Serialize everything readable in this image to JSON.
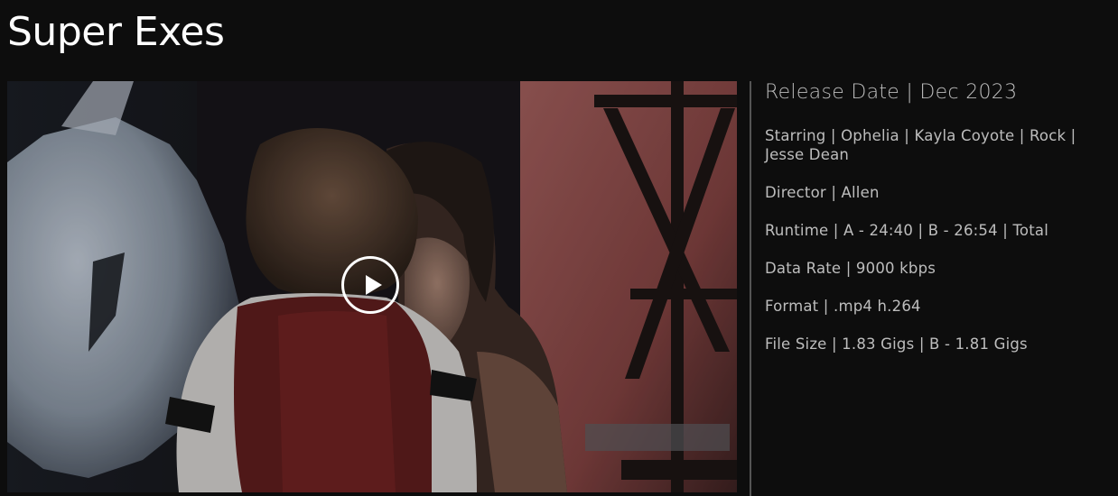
{
  "title": "Super Exes",
  "video": {
    "thumbnail": "video-still-two-people",
    "play_icon": "play-icon"
  },
  "details": {
    "release_date": "Release Date | Dec 2023",
    "starring": "Starring | Ophelia | Kayla Coyote | Rock | Jesse Dean",
    "director": "Director | Allen",
    "runtime": "Runtime | A - 24:40 | B - 26:54 | Total",
    "data_rate": "Data Rate | 9000 kbps",
    "format": "Format | .mp4 h.264",
    "file_size": "File Size | 1.83 Gigs | B - 1.81 Gigs"
  },
  "colors": {
    "background": "#0d0d0d",
    "title": "#ffffff",
    "text": "#bdbdbd",
    "divider": "#555555"
  }
}
